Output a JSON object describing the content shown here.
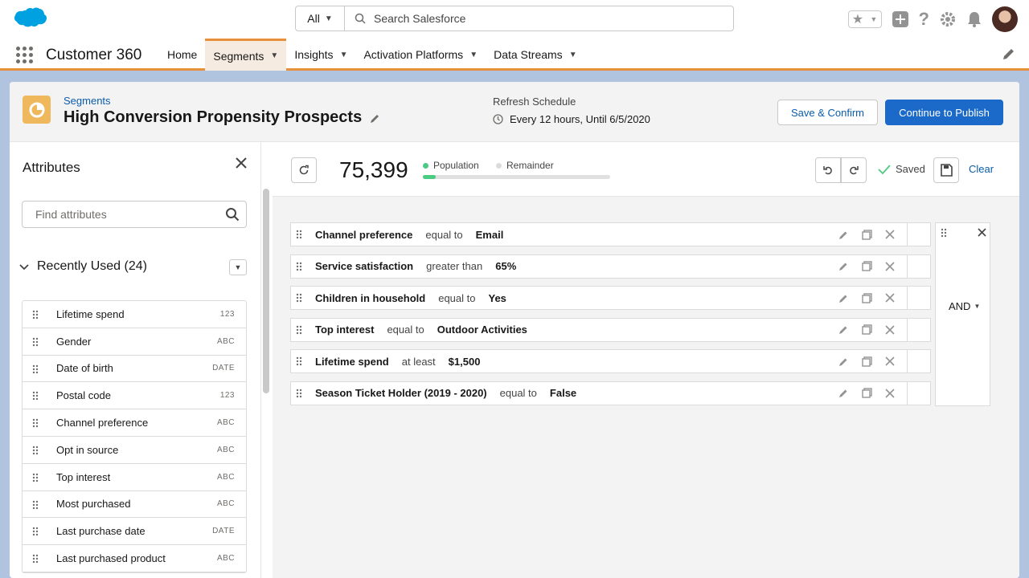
{
  "header": {
    "search_scope": "All",
    "search_placeholder": "Search Salesforce"
  },
  "nav": {
    "app_name": "Customer 360",
    "items": [
      {
        "label": "Home"
      },
      {
        "label": "Segments"
      },
      {
        "label": "Insights"
      },
      {
        "label": "Activation Platforms"
      },
      {
        "label": "Data Streams"
      }
    ]
  },
  "page": {
    "breadcrumb": "Segments",
    "title": "High Conversion Propensity Prospects",
    "refresh_label": "Refresh Schedule",
    "refresh_value": "Every 12 hours,  Until 6/5/2020",
    "save_confirm": "Save & Confirm",
    "continue_publish": "Continue to Publish"
  },
  "attributes": {
    "title": "Attributes",
    "search_placeholder": "Find attributes",
    "section_label": "Recently Used (24)",
    "items": [
      {
        "name": "Lifetime spend",
        "type": "123"
      },
      {
        "name": "Gender",
        "type": "ABC"
      },
      {
        "name": "Date of birth",
        "type": "DATE"
      },
      {
        "name": "Postal code",
        "type": "123"
      },
      {
        "name": "Channel preference",
        "type": "ABC"
      },
      {
        "name": "Opt in source",
        "type": "ABC"
      },
      {
        "name": "Top interest",
        "type": "ABC"
      },
      {
        "name": "Most purchased",
        "type": "ABC"
      },
      {
        "name": "Last purchase date",
        "type": "DATE"
      },
      {
        "name": "Last purchased product",
        "type": "ABC"
      }
    ]
  },
  "builder": {
    "count": "75,399",
    "population_label": "Population",
    "remainder_label": "Remainder",
    "population_fraction": 0.07,
    "saved_label": "Saved",
    "clear_label": "Clear",
    "logic_operator": "AND",
    "conditions": [
      {
        "attribute": "Channel preference",
        "operator": "equal to",
        "value": "Email"
      },
      {
        "attribute": "Service satisfaction",
        "operator": "greater than",
        "value": "65%"
      },
      {
        "attribute": "Children in household",
        "operator": "equal to",
        "value": "Yes"
      },
      {
        "attribute": "Top interest",
        "operator": "equal to",
        "value": "Outdoor Activities"
      },
      {
        "attribute": "Lifetime spend",
        "operator": "at least",
        "value": "$1,500"
      },
      {
        "attribute": "Season Ticket Holder (2019 - 2020)",
        "operator": "equal to",
        "value": "False"
      }
    ]
  },
  "colors": {
    "brand": "#1b6ac9",
    "accent_orange": "#e8913a",
    "population_green": "#4bca81",
    "link": "#0b5cab"
  }
}
